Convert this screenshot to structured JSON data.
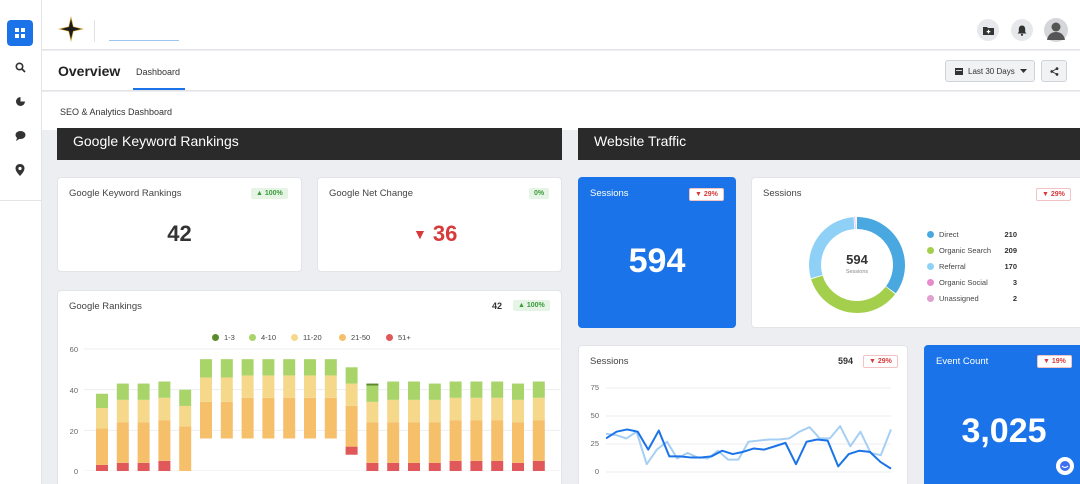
{
  "header": {
    "title": "Overview",
    "tab": "Dashboard",
    "date_range": "Last 30 Days"
  },
  "subtabs": {
    "active": "SEO & Analytics Dashboard"
  },
  "sections": {
    "keywords": "Google Keyword Rankings",
    "traffic": "Website Traffic"
  },
  "cards": {
    "keyword_rankings": {
      "label": "Google Keyword Rankings",
      "badge": "▲ 100%",
      "value": "42"
    },
    "net_change": {
      "label": "Google Net Change",
      "badge": "0%",
      "value": "36",
      "arrow": "▼"
    },
    "sessions_big": {
      "label": "Sessions",
      "badge": "▼ 29%",
      "value": "594"
    },
    "sessions_donut": {
      "label": "Sessions",
      "badge": "▼ 29%",
      "center_value": "594",
      "center_label": "Sessions",
      "legend": [
        {
          "name": "Direct",
          "value": "210",
          "color": "#4aa8e0"
        },
        {
          "name": "Organic Search",
          "value": "209",
          "color": "#a3cf4c"
        },
        {
          "name": "Referral",
          "value": "170",
          "color": "#8fd0f7"
        },
        {
          "name": "Organic Social",
          "value": "3",
          "color": "#e88bcb"
        },
        {
          "name": "Unassigned",
          "value": "2",
          "color": "#e0a0d0"
        }
      ]
    },
    "google_rankings": {
      "label": "Google Rankings",
      "value": "42",
      "badge": "▲ 100%"
    },
    "sessions_line": {
      "label": "Sessions",
      "value": "594",
      "badge": "▼ 29%"
    },
    "event_count": {
      "label": "Event Count",
      "badge": "▼ 19%",
      "value": "3,025"
    }
  },
  "chart_data": [
    {
      "type": "bar",
      "stacked": true,
      "legend": [
        "1-3",
        "4-10",
        "11-20",
        "21-50",
        "51+"
      ],
      "colors": [
        "#5a8a2a",
        "#a8d46a",
        "#f5d88a",
        "#f6bf6a",
        "#e0585a"
      ],
      "ylim": [
        0,
        60
      ],
      "yticks": [
        0,
        20,
        40,
        60
      ],
      "series": [
        {
          "name": "1-3",
          "values": [
            0,
            0,
            0,
            0,
            0,
            0,
            0,
            0,
            0,
            0,
            0,
            0,
            0,
            1,
            0,
            0,
            0,
            0,
            0,
            0,
            0,
            0
          ]
        },
        {
          "name": "4-10",
          "values": [
            7,
            8,
            8,
            8,
            8,
            9,
            9,
            8,
            8,
            8,
            8,
            8,
            8,
            8,
            9,
            9,
            8,
            8,
            8,
            8,
            8,
            8
          ]
        },
        {
          "name": "11-20",
          "values": [
            10,
            11,
            11,
            11,
            10,
            12,
            12,
            11,
            11,
            11,
            11,
            11,
            11,
            10,
            11,
            11,
            11,
            11,
            11,
            11,
            11,
            11
          ]
        },
        {
          "name": "21-50",
          "values": [
            18,
            20,
            20,
            20,
            22,
            18,
            18,
            20,
            20,
            20,
            20,
            20,
            20,
            20,
            20,
            20,
            20,
            20,
            20,
            20,
            20,
            20
          ]
        },
        {
          "name": "51+",
          "values": [
            3,
            4,
            4,
            5,
            0,
            0,
            0,
            0,
            0,
            0,
            0,
            0,
            4,
            4,
            4,
            4,
            4,
            5,
            5,
            5,
            4,
            5
          ]
        }
      ],
      "bottoms": [
        0,
        0,
        0,
        0,
        0,
        16,
        16,
        16,
        16,
        16,
        16,
        16,
        8,
        0,
        0,
        0,
        0,
        0,
        0,
        0,
        0,
        0
      ]
    },
    {
      "type": "line",
      "ylim": [
        0,
        75
      ],
      "yticks": [
        0,
        25,
        50,
        75
      ],
      "series": [
        {
          "name": "",
          "color": "#1a73e8",
          "values": [
            30,
            36,
            38,
            36,
            20,
            37,
            14,
            14,
            13,
            13,
            14,
            19,
            16,
            18,
            21,
            20,
            23,
            26,
            7,
            27,
            29,
            28,
            5,
            16,
            19,
            18,
            9,
            3
          ]
        },
        {
          "name": "",
          "color": "#a6cff3",
          "values": [
            34,
            33,
            30,
            36,
            7,
            20,
            27,
            12,
            17,
            13,
            12,
            19,
            11,
            11,
            27,
            28,
            29,
            29,
            30,
            36,
            40,
            30,
            30,
            41,
            23,
            36,
            17,
            15,
            38
          ]
        }
      ]
    }
  ]
}
